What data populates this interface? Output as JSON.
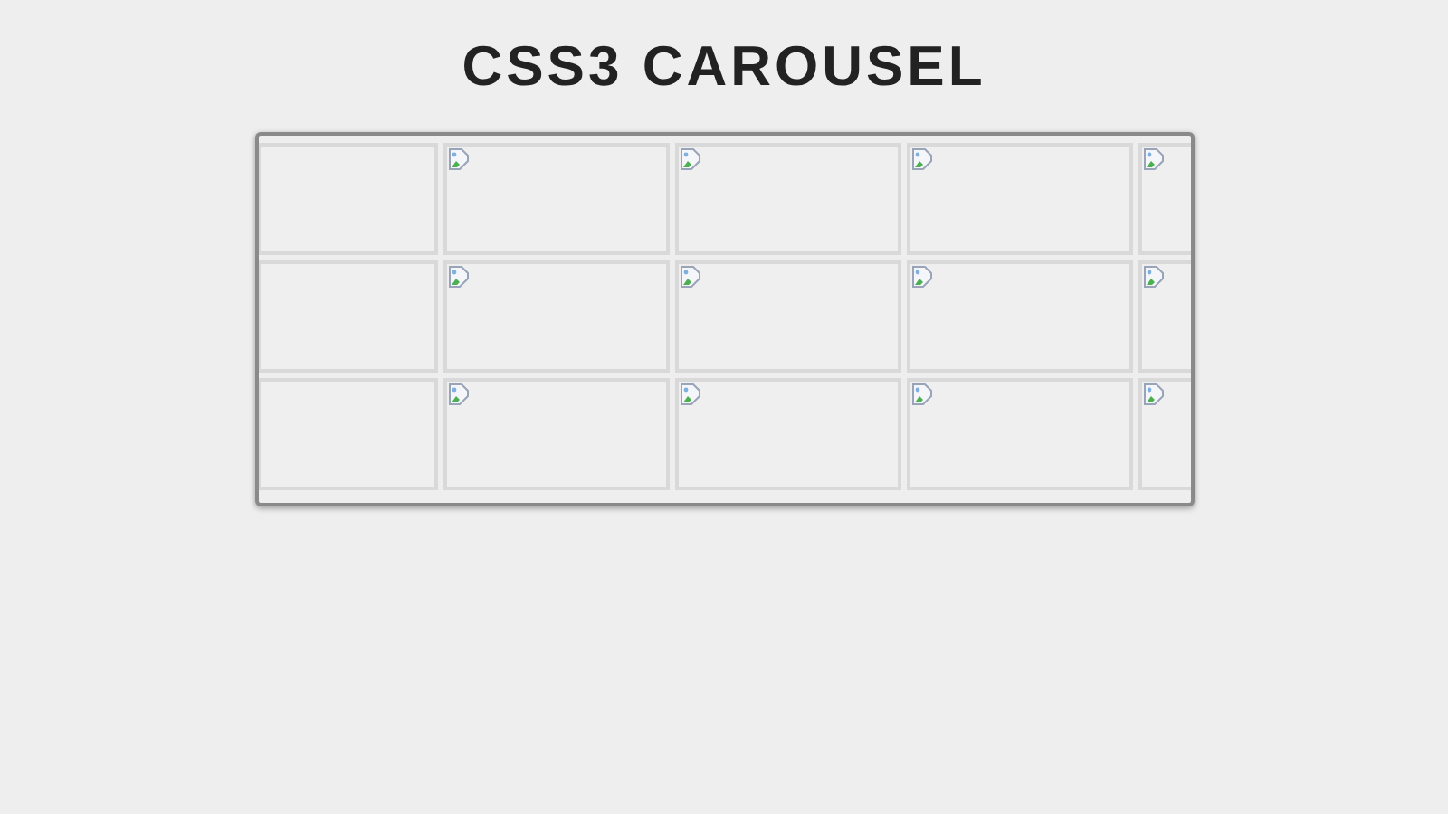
{
  "title": "CSS3 CAROUSEL",
  "rows": [
    {
      "slides": [
        {
          "kind": "empty"
        },
        {
          "kind": "broken_image"
        },
        {
          "kind": "broken_image"
        },
        {
          "kind": "broken_image"
        },
        {
          "kind": "broken_image"
        }
      ]
    },
    {
      "slides": [
        {
          "kind": "empty"
        },
        {
          "kind": "broken_image"
        },
        {
          "kind": "broken_image"
        },
        {
          "kind": "broken_image"
        },
        {
          "kind": "broken_image"
        }
      ]
    },
    {
      "slides": [
        {
          "kind": "empty"
        },
        {
          "kind": "broken_image"
        },
        {
          "kind": "broken_image"
        },
        {
          "kind": "broken_image"
        },
        {
          "kind": "broken_image"
        }
      ]
    }
  ]
}
